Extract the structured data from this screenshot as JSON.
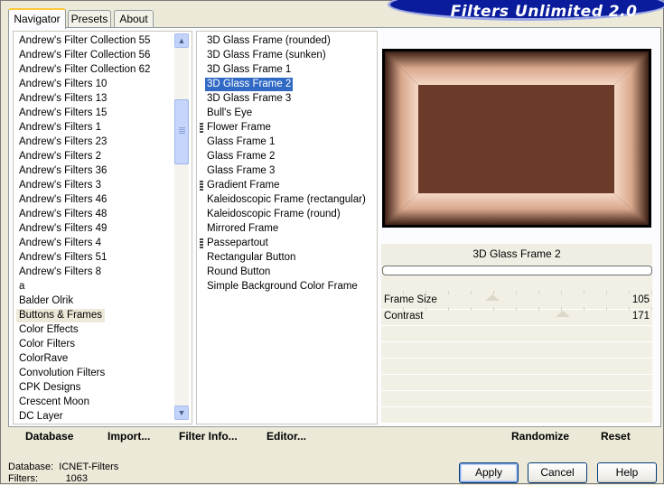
{
  "window": {
    "title": "Filters Unlimited 2.0",
    "tabs": [
      {
        "label": "Navigator",
        "active": true
      },
      {
        "label": "Presets",
        "active": false
      },
      {
        "label": "About",
        "active": false
      }
    ]
  },
  "categories": {
    "items": [
      "Andrew's Filter Collection 55",
      "Andrew's Filter Collection 56",
      "Andrew's Filter Collection 62",
      "Andrew's Filters 10",
      "Andrew's Filters 13",
      "Andrew's Filters 15",
      "Andrew's Filters 1",
      "Andrew's Filters 23",
      "Andrew's Filters 2",
      "Andrew's Filters 36",
      "Andrew's Filters 3",
      "Andrew's Filters 46",
      "Andrew's Filters 48",
      "Andrew's Filters 49",
      "Andrew's Filters 4",
      "Andrew's Filters 51",
      "Andrew's Filters 8",
      "a",
      "Balder Olrik",
      "Buttons & Frames",
      "Color Effects",
      "Color Filters",
      "ColorRave",
      "Convolution Filters",
      "CPK Designs",
      "Crescent Moon",
      "DC Layer"
    ],
    "selected": "Buttons & Frames"
  },
  "filters": {
    "items": [
      {
        "label": "3D Glass Frame (rounded)",
        "marked": false
      },
      {
        "label": "3D Glass Frame (sunken)",
        "marked": false
      },
      {
        "label": "3D Glass Frame 1",
        "marked": false
      },
      {
        "label": "3D Glass Frame 2",
        "marked": false
      },
      {
        "label": "3D Glass Frame 3",
        "marked": false
      },
      {
        "label": "Bull's Eye",
        "marked": false
      },
      {
        "label": "Flower Frame",
        "marked": true
      },
      {
        "label": "Glass Frame 1",
        "marked": false
      },
      {
        "label": "Glass Frame 2",
        "marked": false
      },
      {
        "label": "Glass Frame 3",
        "marked": false
      },
      {
        "label": "Gradient Frame",
        "marked": true
      },
      {
        "label": "Kaleidoscopic Frame (rectangular)",
        "marked": false
      },
      {
        "label": "Kaleidoscopic Frame (round)",
        "marked": false
      },
      {
        "label": "Mirrored Frame",
        "marked": false
      },
      {
        "label": "Passepartout",
        "marked": true
      },
      {
        "label": "Rectangular Button",
        "marked": false
      },
      {
        "label": "Round Button",
        "marked": false
      },
      {
        "label": "Simple Background Color Frame",
        "marked": false
      }
    ],
    "selected": "3D Glass Frame 2"
  },
  "preview": {
    "frame_color": "#d9a88c",
    "inner_color": "#6b3a28",
    "background": "#000000"
  },
  "parameters": {
    "filter_name": "3D Glass Frame 2",
    "progress": 0,
    "items": [
      {
        "name": "Frame Size",
        "value": "105",
        "level": 0.41
      },
      {
        "name": "Contrast",
        "value": "171",
        "level": 0.67
      }
    ]
  },
  "toolbar": {
    "database": "Database",
    "import": "Import...",
    "filter_info": "Filter Info...",
    "editor": "Editor...",
    "randomize": "Randomize",
    "reset": "Reset"
  },
  "status": {
    "database_label": "Database:",
    "database_value": "ICNET-Filters",
    "filters_label": "Filters:",
    "filters_value": "1063"
  },
  "buttons": {
    "apply": "Apply",
    "cancel": "Cancel",
    "help": "Help"
  },
  "icons": {
    "scroll_up": "chevron-up-icon",
    "scroll_down": "chevron-down-icon"
  }
}
